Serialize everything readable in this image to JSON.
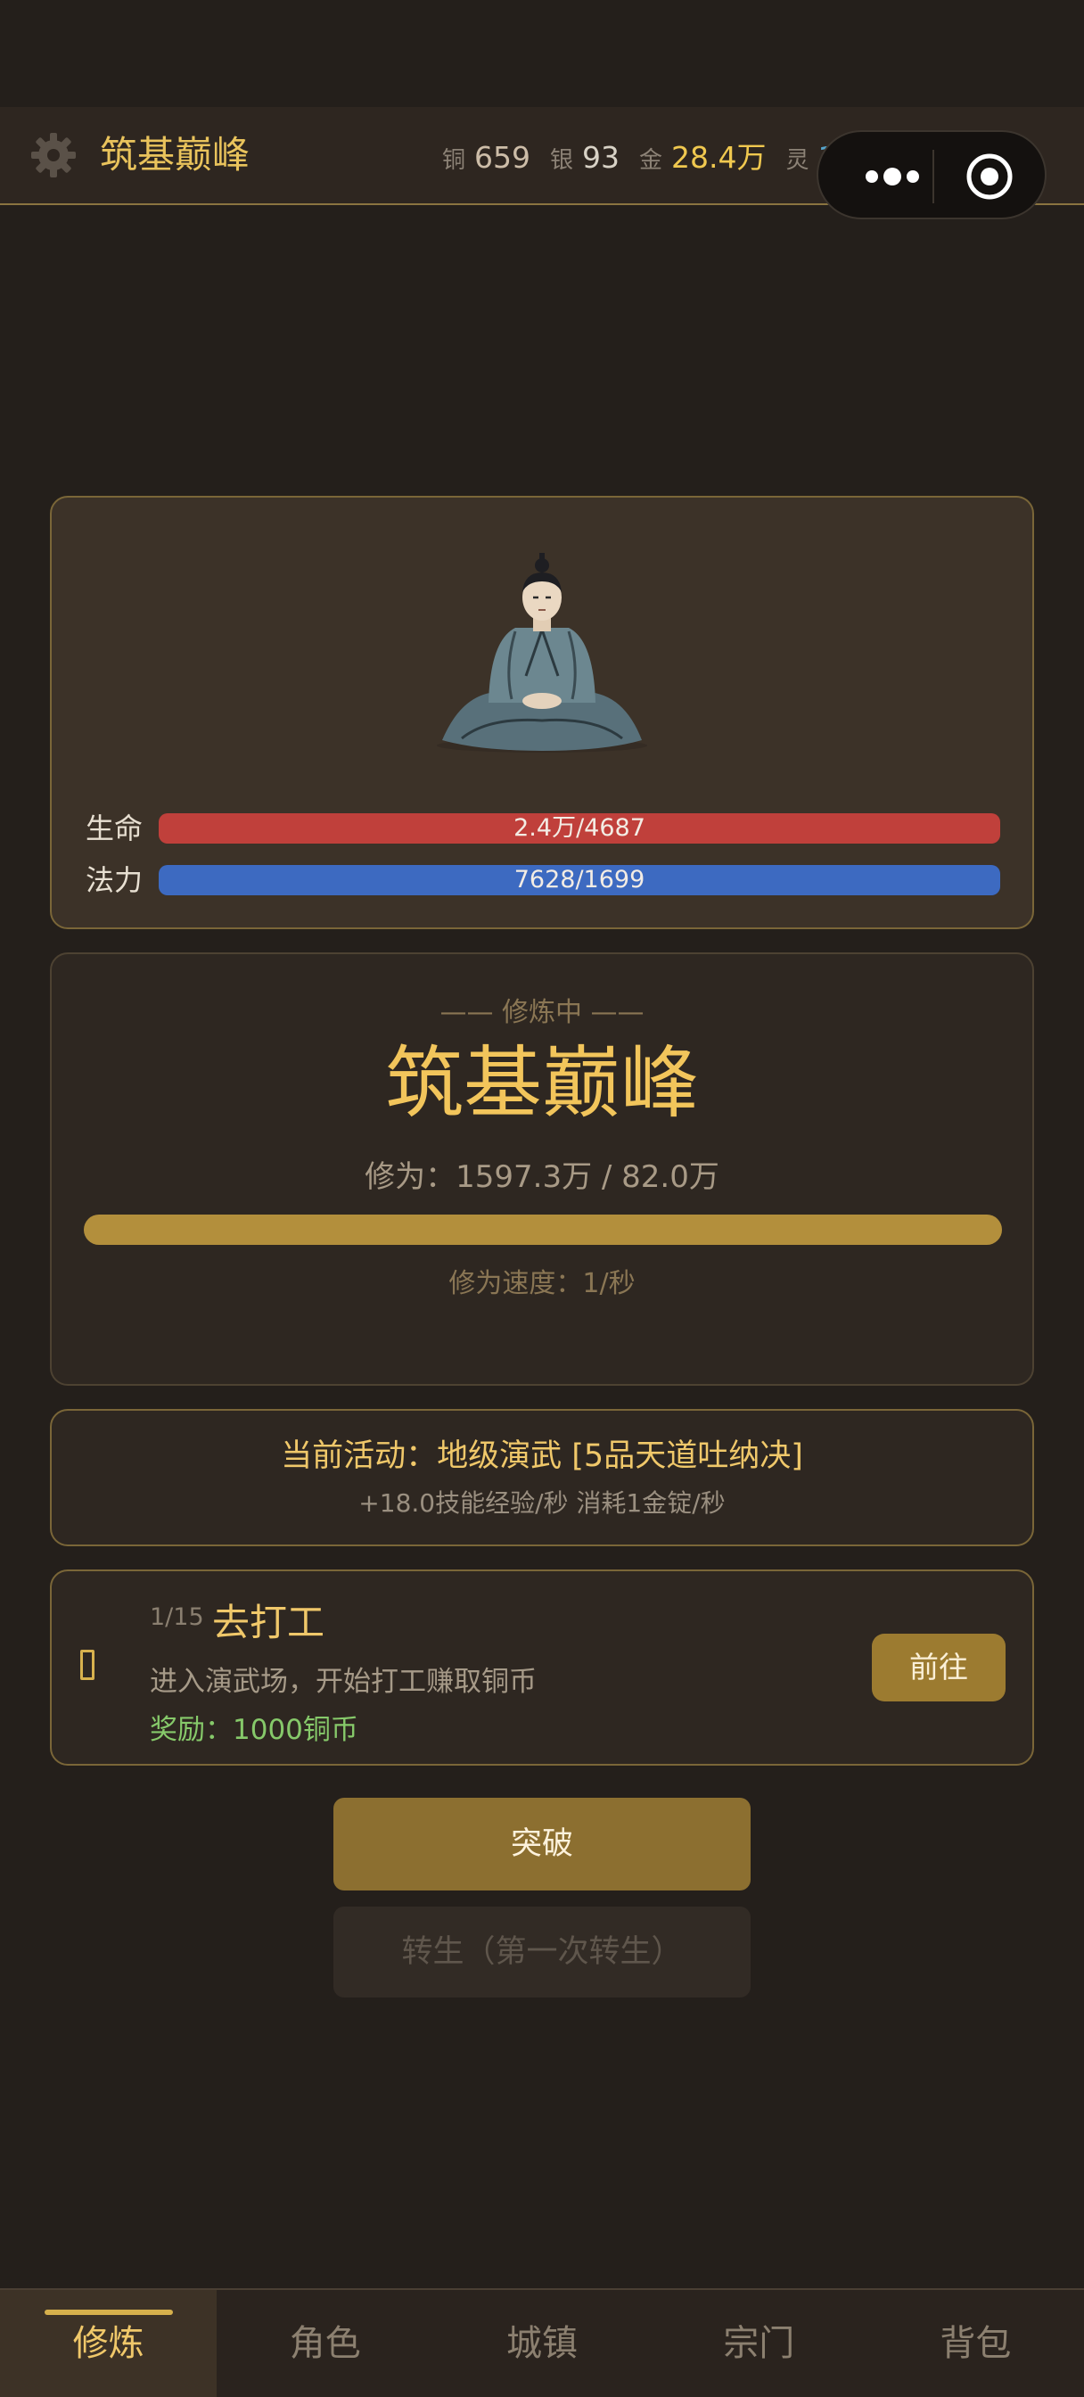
{
  "header": {
    "realm_title": "筑基巅峰",
    "currencies": [
      {
        "label": "铜",
        "value": "659"
      },
      {
        "label": "银",
        "value": "93"
      },
      {
        "label": "金",
        "value": "28.4万"
      },
      {
        "label": "灵",
        "value": "1557"
      }
    ]
  },
  "stats": {
    "hp": {
      "label": "生命",
      "text": "2.4万/4687",
      "fill_fraction": 1.0
    },
    "mp": {
      "label": "法力",
      "text": "7628/1699",
      "fill_fraction": 1.0
    }
  },
  "cultivation": {
    "status": "—— 修炼中 ——",
    "realm": "筑基巅峰",
    "exp_text": "修为：1597.3万 / 82.0万",
    "progress_fraction": 1.0,
    "speed_text": "修为速度：1/秒"
  },
  "activity": {
    "line1": "当前活动：地级演武 [5品天道吐纳决]",
    "line2": "+18.0技能经验/秒  消耗1金锭/秒"
  },
  "task": {
    "progress": "1/15",
    "title": "去打工",
    "description": "进入演武场，开始打工赚取铜币",
    "reward": "奖励：1000铜币",
    "go_label": "前往"
  },
  "actions": {
    "breakthrough_label": "突破",
    "rebirth_label": "转生（第一次转生）"
  },
  "nav": {
    "tabs": [
      "修炼",
      "角色",
      "城镇",
      "宗门",
      "背包"
    ],
    "active_index": 0
  },
  "colors": {
    "gold_accent": "#f0c86a",
    "hp": "#c0403b",
    "mp": "#3d6ac1",
    "progress": "#b38f3c"
  }
}
